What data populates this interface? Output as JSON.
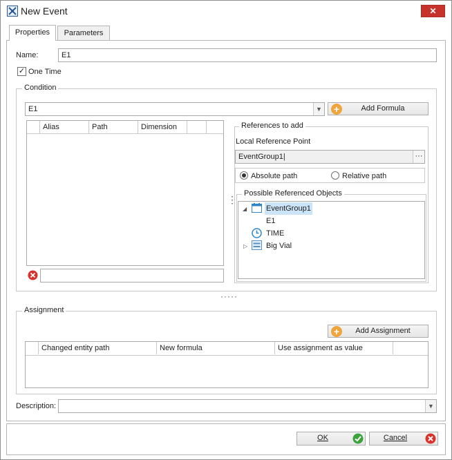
{
  "window": {
    "title": "New Event",
    "close_symbol": "✕",
    "icon": "event-app-icon"
  },
  "tabs": [
    {
      "label": "Properties",
      "active": true
    },
    {
      "label": "Parameters",
      "active": false
    }
  ],
  "name_field": {
    "label": "Name:",
    "value": "E1"
  },
  "one_time": {
    "label": "One Time",
    "checked": true,
    "mark": "✓"
  },
  "condition": {
    "title": "Condition",
    "formula_value": "E1",
    "add_formula_label": "Add Formula",
    "grid_columns": [
      "",
      "Alias",
      "Path",
      "Dimension",
      "",
      ""
    ],
    "error_icon": "error-icon"
  },
  "references": {
    "title": "References to add",
    "local_ref_label": "Local Reference Point",
    "local_ref_value": "EventGroup1|",
    "browse_label": "···",
    "absolute_path_label": "Absolute path",
    "relative_path_label": "Relative path",
    "absolute_selected": true,
    "possible_title": "Possible Referenced Objects",
    "tree": [
      {
        "label": "EventGroup1",
        "expander": "◢",
        "icon": "calendar-icon",
        "selected": true
      },
      {
        "label": "E1",
        "expander": "",
        "icon": "",
        "selected": false
      },
      {
        "label": "TIME",
        "expander": "",
        "icon": "clock-icon",
        "selected": false
      },
      {
        "label": "Big Vial",
        "expander": "▷",
        "icon": "vessel-icon",
        "selected": false
      }
    ]
  },
  "splitter_dots_v": "⋮",
  "splitter_dots_h": "·····",
  "assignment": {
    "title": "Assignment",
    "add_label": "Add Assignment",
    "grid_columns": [
      "",
      "Changed entity path",
      "New formula",
      "Use assignment as value",
      ""
    ]
  },
  "description": {
    "label": "Description:",
    "value": ""
  },
  "footer": {
    "ok_label": "OK",
    "cancel_label": "Cancel",
    "ok_icon": "check-icon",
    "cancel_icon": "cancel-icon"
  },
  "colors": {
    "accent_orange": "#f0a43c",
    "ok_green": "#3ca23c",
    "cancel_red": "#d7322c",
    "selection_blue": "#cce4f7"
  }
}
